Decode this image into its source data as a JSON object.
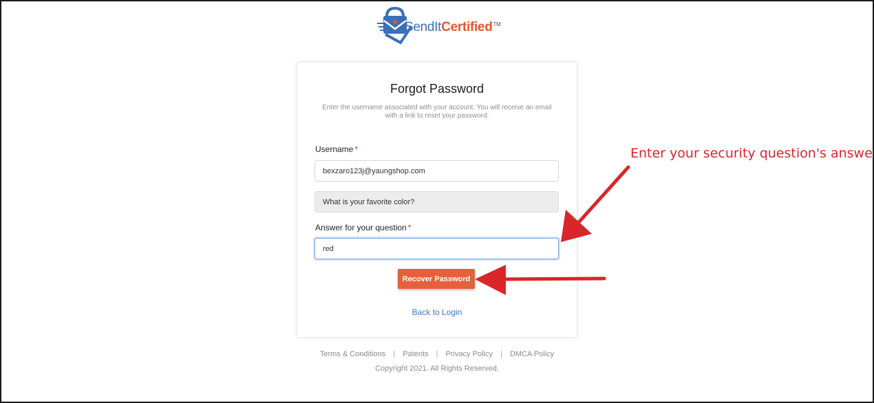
{
  "brand": {
    "logo_text_part1": "SendIt",
    "logo_text_part2": "Certified",
    "logo_tm": "TM"
  },
  "form": {
    "title": "Forgot Password",
    "subtitle": "Enter the username associated with your account. You will receive an email with a link to reset your password.",
    "username_label": "Username",
    "username_required": "*",
    "username_value": "bexzaro123j@yaungshop.com",
    "security_question": "What is your favorite color?",
    "answer_label": "Answer for your question",
    "answer_required": "*",
    "answer_value": "red",
    "recover_button": "Recover Password",
    "back_link": "Back to Login"
  },
  "footer": {
    "links": [
      "Terms & Conditions",
      "Patents",
      "Privacy Policy",
      "DMCA Policy"
    ],
    "separator": "|",
    "copyright": "Copyright 2021. All Rights Reserved."
  },
  "annotation": {
    "text": "Enter your security question's answer",
    "color": "#d8262b"
  },
  "colors": {
    "accent": "#e4613b",
    "link": "#3b78d8",
    "brand_blue": "#3b6fb6"
  }
}
